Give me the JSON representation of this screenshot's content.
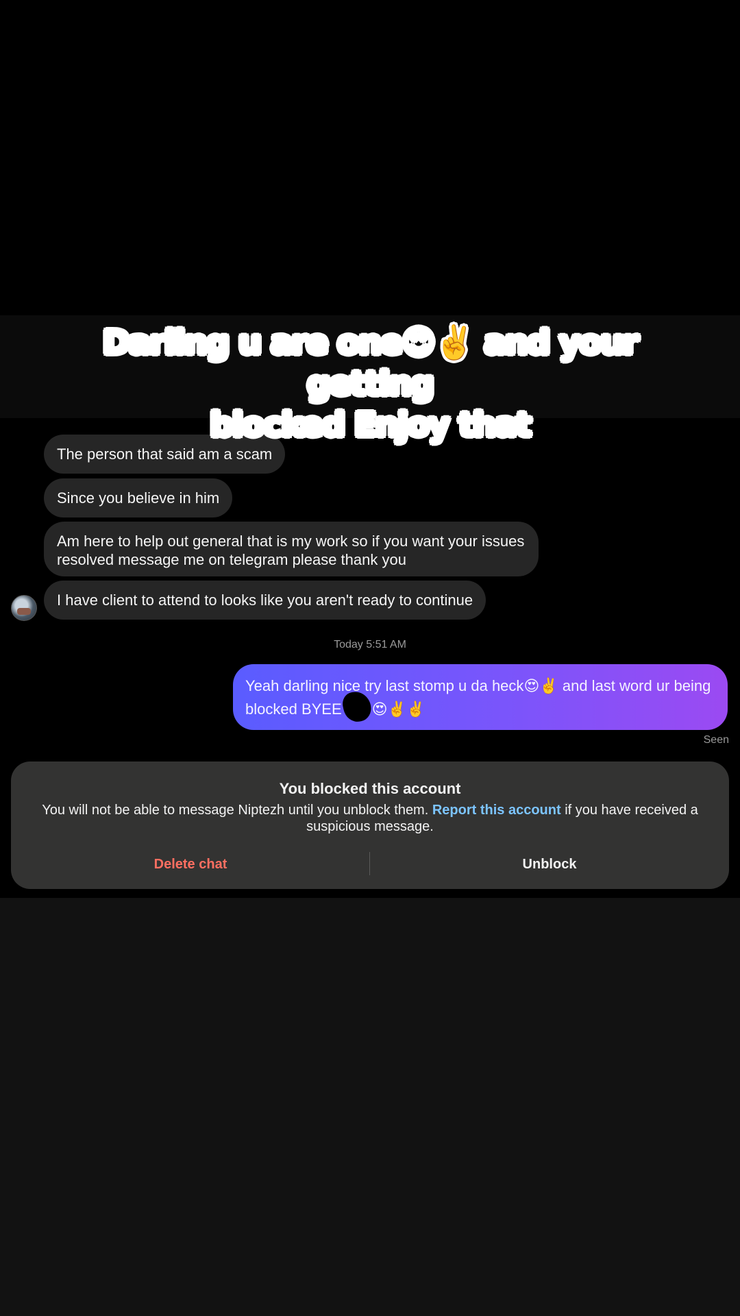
{
  "overlay": {
    "caption_line1": "Darling u are one😍✌️ and your getting",
    "caption_line2": "blocked Enjoy that"
  },
  "messages_in": [
    "The person that said am a scam",
    "Since you believe in him",
    "Am here to help out general that is my work so if you want your issues resolved message me on telegram please thank you",
    "I have client to attend to looks like you aren't ready to continue"
  ],
  "timestamp": "Today 5:51 AM",
  "message_out": {
    "part1": "Yeah darling nice try last stomp u da heck😍✌️ and last word ur being blocked BYEE",
    "part2": "😍✌️✌️"
  },
  "seen_label": "Seen",
  "blocked_notice": {
    "title": "You blocked this account",
    "desc_before": "You will not be able to message Niptezh until you unblock them. ",
    "report_link": "Report this account",
    "desc_after": " if you have received a suspicious message.",
    "delete_label": "Delete chat",
    "unblock_label": "Unblock"
  },
  "colors": {
    "outgoing_gradient_start": "#5a5cff",
    "outgoing_gradient_end": "#9b4af2",
    "incoming_bubble": "#262626",
    "delete_red": "#ff6f61",
    "link_blue": "#7cc4ff"
  },
  "icons": {
    "avatar": "contact-avatar"
  }
}
